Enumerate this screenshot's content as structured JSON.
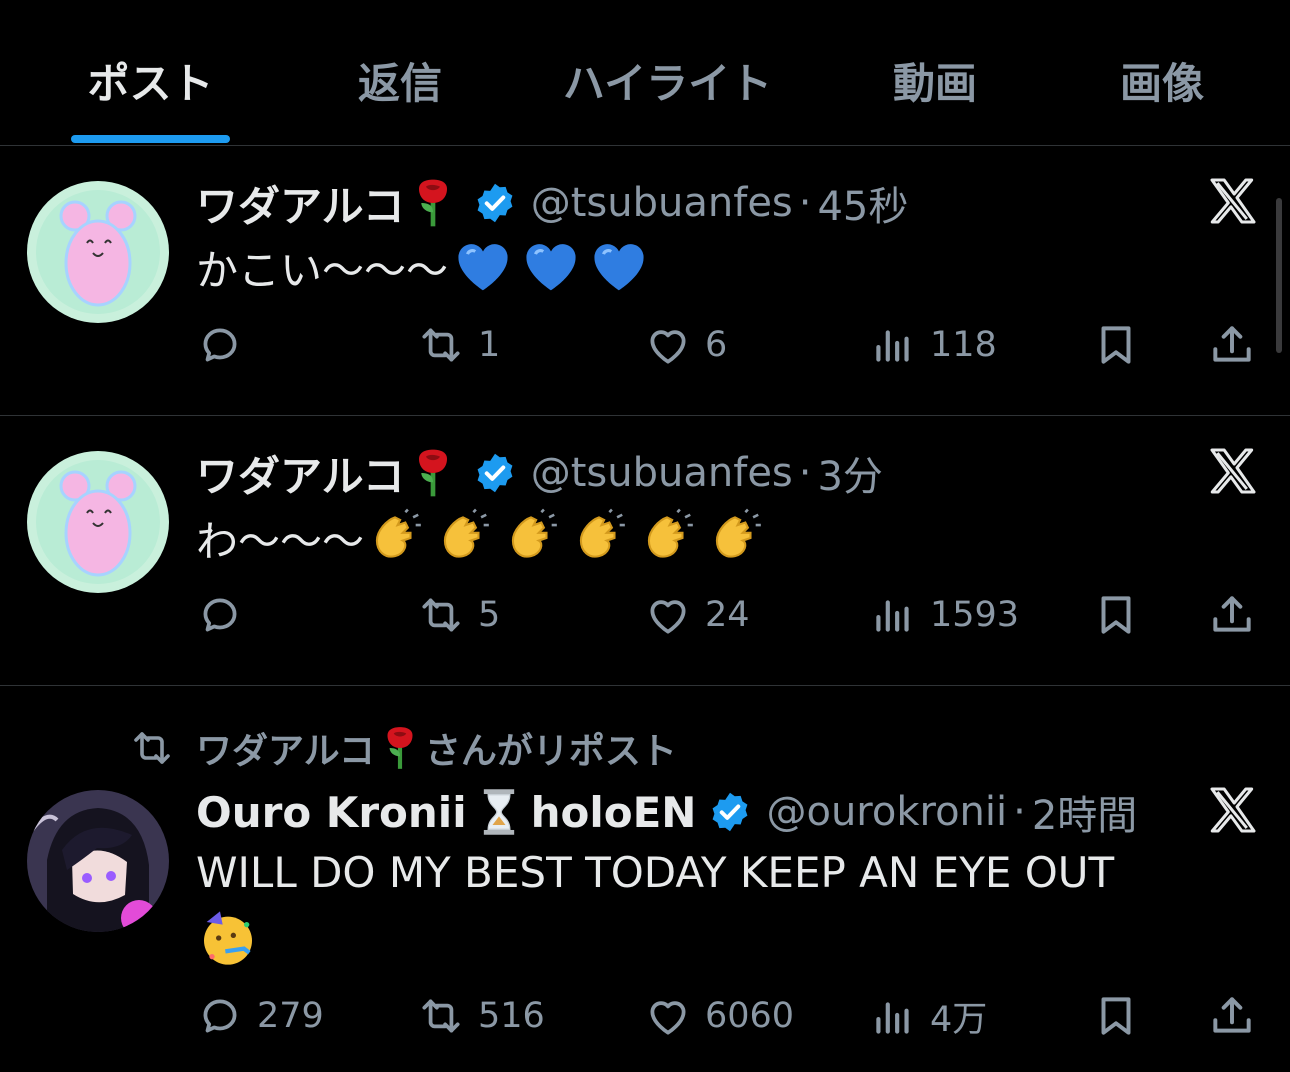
{
  "tabs": [
    {
      "label": "ポスト",
      "active": true
    },
    {
      "label": "返信",
      "active": false
    },
    {
      "label": "ハイライト",
      "active": false
    },
    {
      "label": "動画",
      "active": false
    },
    {
      "label": "画像",
      "active": false
    }
  ],
  "posts": [
    {
      "name": "ワダアルコ",
      "handle": "@tsubuanfes",
      "dot": "·",
      "time": "45秒",
      "text": "かこい〜〜〜",
      "replies": "",
      "reposts": "1",
      "likes": "6",
      "views": "118"
    },
    {
      "name": "ワダアルコ",
      "handle": "@tsubuanfes",
      "dot": "·",
      "time": "3分",
      "text": "わ〜〜〜",
      "replies": "",
      "reposts": "5",
      "likes": "24",
      "views": "1593"
    },
    {
      "repost_by_name": "ワダアルコ",
      "repost_by_suffix": "さんがリポスト",
      "name": "Ouro Kronii",
      "name_suffix": "holoEN",
      "handle": "@ourokronii",
      "dot": "·",
      "time": "2時間",
      "text": "WILL DO MY BEST TODAY KEEP AN EYE OUT",
      "replies": "279",
      "reposts": "516",
      "likes": "6060",
      "views": "4万"
    }
  ],
  "colors": {
    "accent": "#1d9bf0",
    "muted": "#8b98a5",
    "text": "#e7e9ea",
    "background": "#000000"
  },
  "icons": [
    "reply-icon",
    "repost-icon",
    "like-icon",
    "views-icon",
    "bookmark-icon",
    "share-icon",
    "verified-badge-icon",
    "x-logo-icon",
    "rose-emoji",
    "blue-heart-emoji",
    "clap-emoji",
    "hourglass-emoji",
    "party-face-emoji"
  ]
}
